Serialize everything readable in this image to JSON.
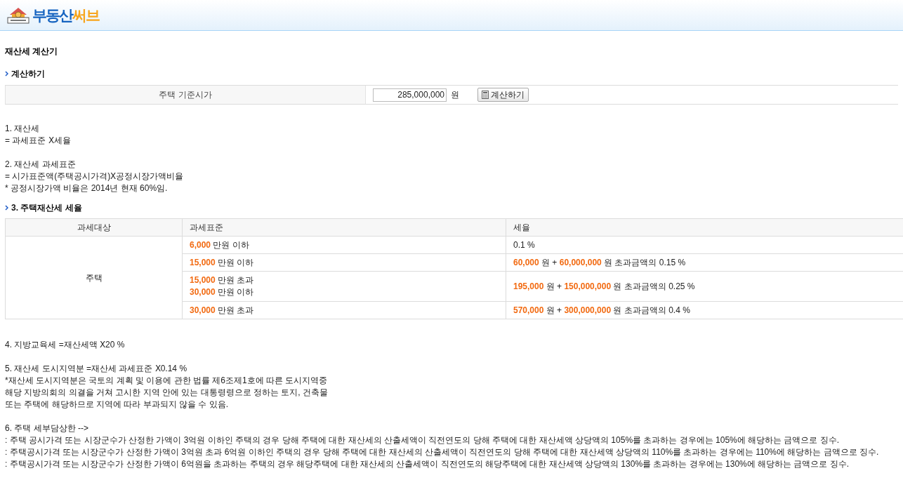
{
  "header": {
    "logo": {
      "part_1": "부동산",
      "part_2": "써브"
    }
  },
  "page_title": "재산세 계산기",
  "calculator": {
    "heading": "계산하기",
    "label": "주택 기준시가",
    "input": {
      "value": "285,000,000"
    },
    "unit": "원",
    "button": "계산하기"
  },
  "notes_1": [
    {
      "lines": [
        "1. 재산세",
        "= 과세표준 Ⅹ세율"
      ]
    },
    {
      "lines": [
        "2. 재산세 과세표준",
        "= 시가표준액(주택공시가격)Ⅹ공정시장가액비율",
        "* 공정시장가액 비율은 2014년 현재 60%임."
      ]
    }
  ],
  "rate_section": {
    "heading": "3. 주택재산세 세율",
    "columns": [
      "과세대상",
      "과세표준",
      "세율"
    ],
    "target": "주택",
    "rows": [
      {
        "base": [
          "**6,000** 만원 이하"
        ],
        "rate": "0.1 %"
      },
      {
        "base": [
          "**15,000** 만원 이하"
        ],
        "rate": "**60,000** 원 + **60,000,000** 원 초과금액의 0.15 %"
      },
      {
        "base": [
          "**15,000** 만원 초과",
          "**30,000** 만원 이하"
        ],
        "rate": "**195,000** 원 + **150,000,000** 원 초과금액의 0.25 %"
      },
      {
        "base": [
          "**30,000** 만원 초과"
        ],
        "rate": "**570,000** 원 + **300,000,000** 원 초과금액의 0.4 %"
      }
    ]
  },
  "notes_2": [
    {
      "lines": [
        "4. 지방교육세 =재산세액 Ⅹ20 %"
      ]
    },
    {
      "lines": [
        "5. 재산세 도시지역분 =재산세 과세표준 Ⅹ0.14 %",
        "*재산세 도시지역분은 국토의 계획 및 이용에 관한 법률 제6조제1호에 따른 도시지역중",
        "해당 지방의회의 의결을 거쳐 고시한 지역 안에 있는 대통령령으로 정하는 토지, 건축물",
        "또는 주택에 해당하므로 지역에 따라 부과되지 않을 수 있음."
      ]
    },
    {
      "lines": [
        "6. 주택 세부담상한 -->",
        ": 주택 공시가격 또는 시장군수가 산정한 가액이 3억원 이하인 주택의 경우 당해 주택에 대한 재산세의 산출세액이 직전연도의 당해 주택에 대한 재산세액 상당액의 105%를 초과하는 경우에는 105%에 해당하는 금액으로 징수.",
        ": 주택공시가격 또는 시장군수가 산정한 가액이 3억원 초과 6억원 이하인 주택의 경우 당해 주택에 대한 재산세의 산출세액이 직전연도의 당해 주택에 대한 재산세액 상당액의 110%를 초과하는 경우에는 110%에 해당하는 금액으로 징수.",
        ": 주택공시가격 또는 시장군수가 산정한 가액이 6억원을 초과하는 주택의 경우 해당주택에 대한 재산세의 산출세액이 직전연도의 해당주택에 대한 재산세액 상당액의 130%를 초과하는 경우에는 130%에 해당하는 금액으로 징수."
      ]
    }
  ]
}
